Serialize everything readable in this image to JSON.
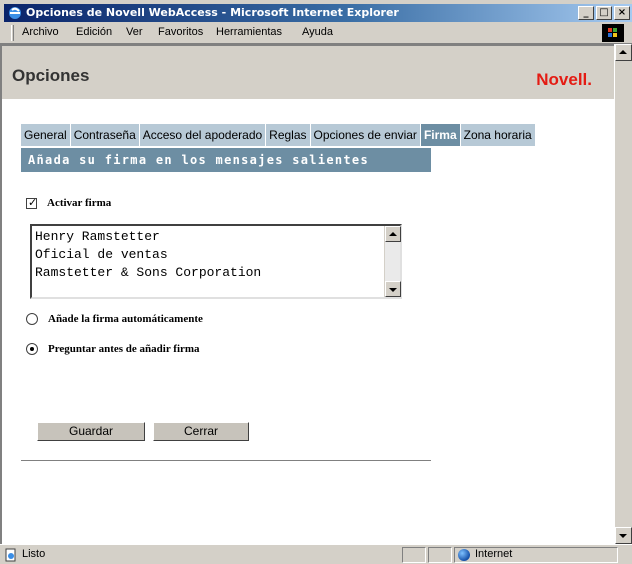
{
  "window": {
    "title": "Opciones de Novell WebAccess - Microsoft Internet Explorer"
  },
  "menu": [
    "Archivo",
    "Edición",
    "Ver",
    "Favoritos",
    "Herramientas",
    "Ayuda"
  ],
  "header": {
    "title": "Opciones",
    "brand": "Novell."
  },
  "tabs": [
    {
      "label": "General",
      "active": false
    },
    {
      "label": "Contraseña",
      "active": false
    },
    {
      "label": "Acceso del apoderado",
      "active": false
    },
    {
      "label": "Reglas",
      "active": false
    },
    {
      "label": "Opciones de enviar",
      "active": false
    },
    {
      "label": "Firma",
      "active": true
    },
    {
      "label": "Zona horaria",
      "active": false
    }
  ],
  "section": {
    "heading": "Añada su firma en los mensajes salientes"
  },
  "signature": {
    "enable_label": "Activar firma",
    "enabled": true,
    "text": "Henry Ramstetter\nOficial de ventas\nRamstetter & Sons Corporation"
  },
  "options": {
    "auto_label": "Añade la firma automáticamente",
    "auto_selected": false,
    "ask_label": "Preguntar antes de añadir firma",
    "ask_selected": true
  },
  "buttons": {
    "save": "Guardar",
    "close": "Cerrar"
  },
  "status": {
    "text": "Listo",
    "zone": "Internet"
  },
  "colors": {
    "tab_bg": "#b7c9d6",
    "tab_active_bg": "#6d8ea3",
    "section_bg": "#6d8ea3",
    "brand_red": "#e41b13"
  }
}
